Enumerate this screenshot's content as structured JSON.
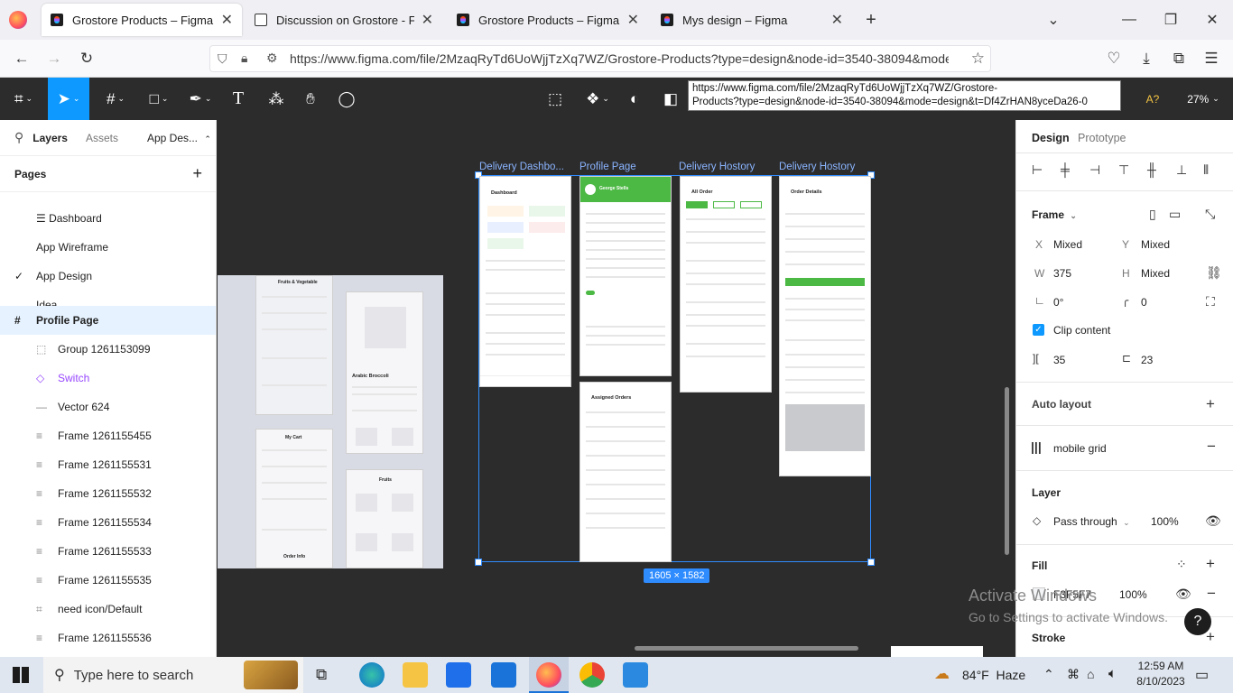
{
  "browser": {
    "tabs": [
      {
        "title": "Grostore Products – Figma",
        "active": true
      },
      {
        "title": "Discussion on Grostore - Food & ...",
        "active": false
      },
      {
        "title": "Grostore Products – Figma",
        "active": false
      },
      {
        "title": "Mys design – Figma",
        "active": false
      }
    ],
    "new_tab": "+",
    "url": "https://www.figma.com/file/2MzaqRyTd6UoWjjTzXq7WZ/Grostore-Products?type=design&node-id=3540-38094&mode=...",
    "tooltip_line1": "https://www.figma.com/file/2MzaqRyTd6UoWjjTzXq7WZ/Grostore-",
    "tooltip_line2": "Products?type=design&node-id=3540-38094&mode=design&t=Df4ZrHAN8yceDa26-0"
  },
  "figma_toolbar": {
    "zoom": "27%",
    "share_hint": "A?"
  },
  "left_panel": {
    "tabs": [
      "Layers",
      "Assets"
    ],
    "page_dropdown": "App Des...",
    "pages_title": "Pages",
    "pages": [
      {
        "label": "☰ Dashboard",
        "current": false
      },
      {
        "label": "App Wireframe",
        "current": false
      },
      {
        "label": "App Design",
        "current": true
      },
      {
        "label": "Idea",
        "current": false
      }
    ],
    "layers": [
      {
        "label": "Profile Page",
        "icon": "#",
        "kind": "frame-selected"
      },
      {
        "label": "Group 1261153099",
        "icon": "⬚",
        "kind": "group"
      },
      {
        "label": "Switch",
        "icon": "◇",
        "kind": "component"
      },
      {
        "label": "Vector 624",
        "icon": "—",
        "kind": "vector"
      },
      {
        "label": "Frame 1261155455",
        "icon": "≡",
        "kind": "frame"
      },
      {
        "label": "Frame 1261155531",
        "icon": "≡",
        "kind": "frame"
      },
      {
        "label": "Frame 1261155532",
        "icon": "≡",
        "kind": "frame"
      },
      {
        "label": "Frame 1261155534",
        "icon": "≡",
        "kind": "frame"
      },
      {
        "label": "Frame 1261155533",
        "icon": "≡",
        "kind": "frame"
      },
      {
        "label": "Frame 1261155535",
        "icon": "≡",
        "kind": "frame"
      },
      {
        "label": "need icon/Default",
        "icon": "⌗",
        "kind": "instance"
      },
      {
        "label": "Frame 1261155536",
        "icon": "≡",
        "kind": "frame"
      }
    ]
  },
  "canvas": {
    "frame_labels": [
      "Delivery Dashbo...",
      "Profile Page",
      "Delivery Hostory",
      "Delivery Hostory"
    ],
    "selection_size": "1605 × 1582",
    "screens": {
      "dashboard_title": "Dashboard",
      "all_order_title": "All Order",
      "order_details_title": "Order Details",
      "assigned_orders_title": "Assigned Orders",
      "profile_name": "George Stells",
      "left_fragment_title1": "Fruits & Vegetable",
      "left_fragment_title2": "Arabic Broccoli",
      "left_fragment_title3": "My Cart",
      "left_fragment_title4": "Fruits",
      "left_fragment_title5": "Order Info"
    }
  },
  "right_panel": {
    "tabs": [
      "Design",
      "Prototype"
    ],
    "frame_label": "Frame",
    "x_label": "X",
    "x_value": "Mixed",
    "y_label": "Y",
    "y_value": "Mixed",
    "w_label": "W",
    "w_value": "375",
    "h_label": "H",
    "h_value": "Mixed",
    "rotation": "0°",
    "radius": "0",
    "clip_content": "Clip content",
    "spacing_left": "35",
    "spacing_right": "23",
    "auto_layout": "Auto layout",
    "grid_name": "mobile grid",
    "layer_title": "Layer",
    "blend_mode": "Pass through",
    "opacity": "100%",
    "fill_title": "Fill",
    "fill_hex": "F3F5F7",
    "fill_opacity": "100%",
    "stroke_title": "Stroke",
    "help": "?"
  },
  "watermark": {
    "line1": "Activate Windows",
    "line2": "Go to Settings to activate Windows."
  },
  "taskbar": {
    "search_placeholder": "Type here to search",
    "weather": "84°F  Haze",
    "time": "12:59 AM",
    "date": "8/10/2023"
  },
  "colors": {
    "accent": "#0d99ff",
    "selection": "#2f8cff",
    "app_green": "#4cb944",
    "canvas_bg": "#2c2c2c"
  }
}
